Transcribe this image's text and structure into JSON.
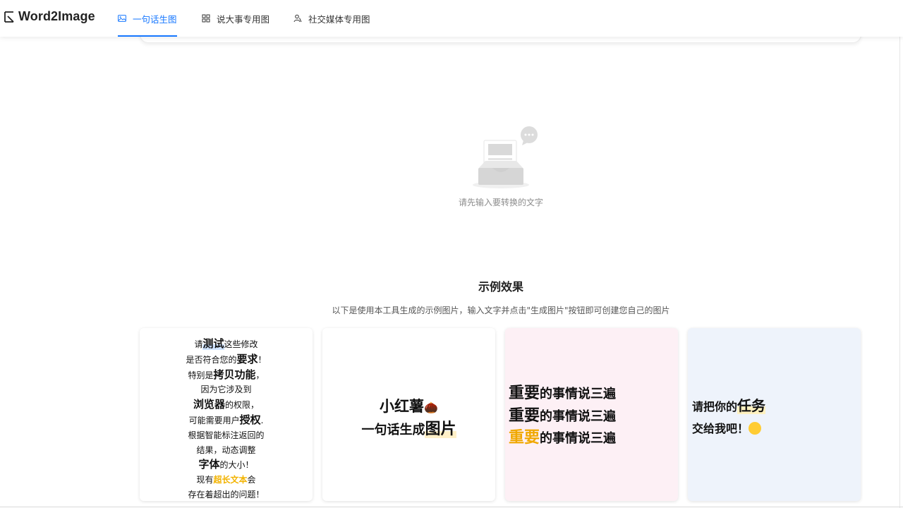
{
  "app": {
    "brand": "Word2Image"
  },
  "nav": {
    "tabs": [
      {
        "label": "一句话生图",
        "icon": "image-icon",
        "active": true
      },
      {
        "label": "说大事专用图",
        "icon": "grid-icon",
        "active": false
      },
      {
        "label": "社交媒体专用图",
        "icon": "people-icon",
        "active": false
      }
    ]
  },
  "empty_state": {
    "message": "请先输入要转换的文字",
    "icon": "empty-inbox-icon"
  },
  "examples": {
    "title": "示例效果",
    "subtitle": "以下是使用本工具生成的示例图片，输入文字并点击\"生成图片\"按钮即可创建您自己的图片",
    "card1": {
      "l1a": "请",
      "l1b": "测试",
      "l1c": "这些修改",
      "l2a": "是否符合您的",
      "l2b": "要求",
      "l2c": "！",
      "l3a": "特别是",
      "l3b": "拷贝功能",
      "l3c": "，",
      "l4": "因为它涉及到",
      "l5a": "浏览器",
      "l5b": "的权限，",
      "l6a": "可能需要用户",
      "l6b": "授权",
      "l6c": ".",
      "l7": "根据智能标注返回的",
      "l8": "结果，动态调整",
      "l9a": "字体",
      "l9b": "的大小！",
      "l10a": "现有",
      "l10b": "超长文本",
      "l10c": "会",
      "l11": "存在着超出的问题！"
    },
    "card2": {
      "l1a": "小红薯",
      "l1b": "🌰",
      "l2a": "一句话生成",
      "l2b": "图片"
    },
    "card3": {
      "big": "重要",
      "rest": "的事情说三遍"
    },
    "card4": {
      "l1a": "请把你的",
      "l1b": "任务",
      "l2": "交给我吧！"
    }
  },
  "colors": {
    "accent": "#1677ff",
    "gold": "#f2b300",
    "pink_card": "#fdf0f5",
    "blue_card": "#eef3fb"
  }
}
